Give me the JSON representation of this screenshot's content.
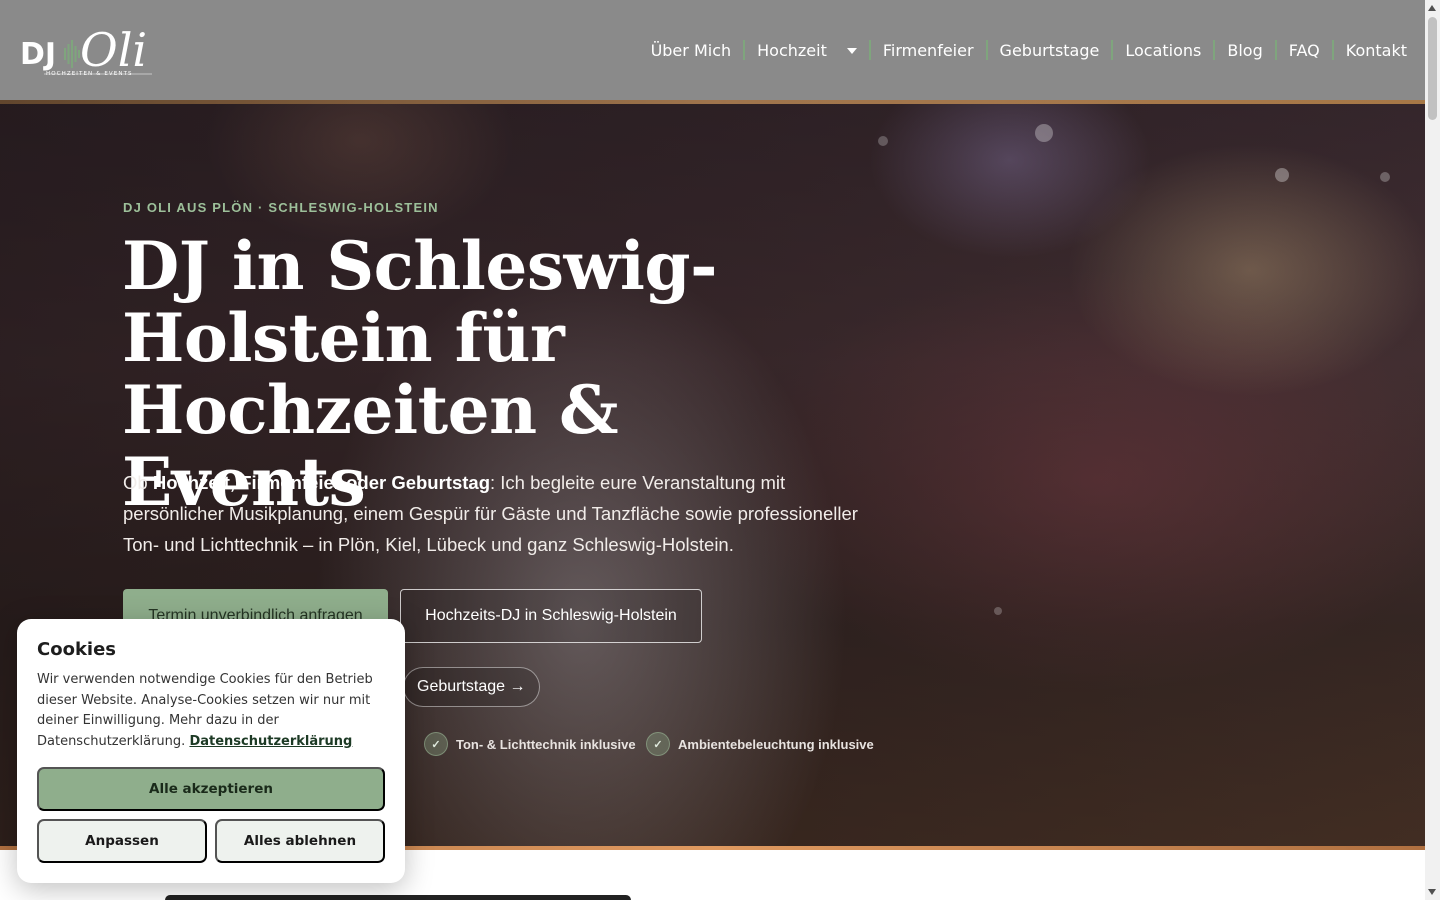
{
  "header": {
    "logo_sub": "HOCHZEITEN & EVENTS",
    "nav": [
      {
        "label": "Über Mich"
      },
      {
        "label": "Hochzeit",
        "has_dropdown": true
      },
      {
        "label": "Firmenfeier"
      },
      {
        "label": "Geburtstage"
      },
      {
        "label": "Locations"
      },
      {
        "label": "Blog"
      },
      {
        "label": "FAQ"
      },
      {
        "label": "Kontakt"
      }
    ]
  },
  "hero": {
    "eyebrow": "DJ OLI AUS PLÖN · SCHLESWIG-HOLSTEIN",
    "title": "DJ in Schleswig-Holstein für Hochzeiten & Events",
    "text_prefix": "Ob ",
    "text_bold": "Hochzeit, Firmenfeier oder Geburtstag",
    "text_rest": ": Ich begleite eure Veranstaltung mit persönlicher Musikplanung, einem Gespür für Gäste und Tanzfläche sowie professioneller Ton- und Lichttechnik – in Plön, Kiel, Lübeck und ganz Schleswig-Holstein.",
    "btn_primary": "Termin unverbindlich anfragen",
    "btn_outline": "Hochzeits-DJ in Schleswig-Holstein",
    "chip": "Geburtstage →",
    "features": [
      {
        "icon": "check-icon",
        "label": "Ton- & Lichttechnik inklusive"
      },
      {
        "icon": "check-icon",
        "label": "Ambientebeleuchtung inklusive"
      }
    ]
  },
  "cookie": {
    "title": "Cookies",
    "text": "Wir verwenden notwendige Cookies für den Betrieb dieser Website. Analyse-Cookies setzen wir nur mit deiner Einwilligung. Mehr dazu in der Datenschutzerklärung.",
    "link": "Datenschutzerklärung",
    "accept": "Alle akzeptieren",
    "customize": "Anpassen",
    "reject": "Alles ablehnen"
  },
  "colors": {
    "header_bg": "#8a8a8a",
    "accent_green": "#8fae8c",
    "eyebrow_green": "#9dc09a"
  }
}
